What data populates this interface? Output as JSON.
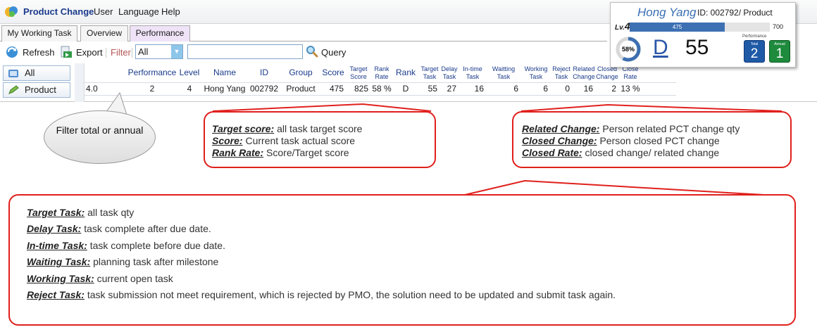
{
  "menubar": {
    "app_title": "Product Change",
    "items": [
      "User",
      "Language",
      "Help"
    ]
  },
  "tabs": [
    "My Working Task",
    "Overview",
    "Performance"
  ],
  "active_tab": "Performance",
  "toolbar": {
    "refresh": "Refresh",
    "export": "Export",
    "filter_label": "Filter",
    "filter_value": "All",
    "query_value": "",
    "query": "Query"
  },
  "sidebar": [
    "All",
    "Product"
  ],
  "grid": {
    "columns": [
      "Performance",
      "Level",
      "Name",
      "ID",
      "Group",
      "Score",
      "Target Score",
      "Rank Rate",
      "Rank",
      "Target Task",
      "Delay Task",
      "In-time Task",
      "Waitting Task",
      "Working Task",
      "Reject Task",
      "Related Change",
      "Closed Change",
      "Close Rate"
    ],
    "row_prefix": "4.0",
    "row": [
      "2",
      "4",
      "Hong Yang",
      "002792",
      "Product",
      "475",
      "825",
      "58 %",
      "D",
      "55",
      "27",
      "16",
      "6",
      "6",
      "0",
      "16",
      "2",
      "13 %"
    ]
  },
  "card": {
    "name": "Hong Yang",
    "id_text": "ID: 002792/ Product",
    "level_prefix": "Lv.",
    "level": "4",
    "progress_value": "475",
    "progress_max": "700",
    "progress_fraction": 0.679,
    "ring_percent": "58%",
    "ring_fraction": 0.58,
    "rank": "D",
    "score": "55",
    "performance_label": "Performance",
    "total_label": "Total",
    "total_value": "2",
    "annual_label": "Annual",
    "annual_value": "1"
  },
  "bubble_text": "Filter total or annual",
  "callout_score": [
    {
      "term": "Target score:",
      "desc": " all task target score"
    },
    {
      "term": "Score:",
      "desc": " Current task actual score"
    },
    {
      "term": "Rank Rate:",
      "desc": " Score/Target score"
    }
  ],
  "callout_change": [
    {
      "term": "Related Change:",
      "desc": " Person related PCT change qty"
    },
    {
      "term": "Closed Change:",
      "desc": " Person closed PCT change"
    },
    {
      "term": "Closed Rate:",
      "desc": " closed change/ related change"
    }
  ],
  "callout_task": [
    {
      "term": "Target Task:",
      "desc": " all task qty"
    },
    {
      "term": "Delay Task:",
      "desc": " task complete after due date."
    },
    {
      "term": "In-time Task:",
      "desc": " task complete before due date."
    },
    {
      "term": "Waiting Task:",
      "desc": " planning task after milestone"
    },
    {
      "term": "Working Task:",
      "desc": " current open task"
    },
    {
      "term": "Reject Task:",
      "desc": " task submission not meet requirement, which is rejected by PMO, the solution need to be updated and submit task again."
    }
  ],
  "colors": {
    "accent": "#3d70b3",
    "callout_border": "#e0201c",
    "badge_total": "#1f5aa6",
    "badge_annual": "#1e8a3c",
    "ring": "#3d6fb0",
    "tab_active": "#efe3f7"
  },
  "icons": [
    "product-change-app-icon",
    "refresh-icon",
    "export-icon",
    "query-magnifier-icon",
    "all-folder-icon",
    "product-pencil-icon"
  ]
}
